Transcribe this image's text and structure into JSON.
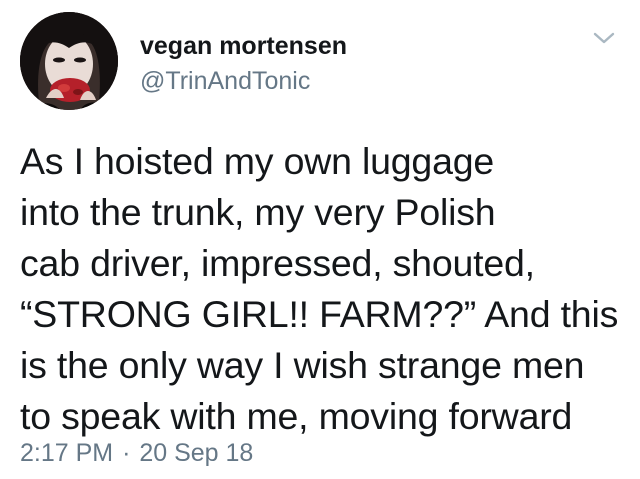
{
  "author": {
    "display_name": "vegan mortensen",
    "handle": "@TrinAndTonic",
    "avatar_icon": "profile-photo"
  },
  "tweet": {
    "lines": [
      "As I hoisted my own luggage",
      "into the trunk, my very Polish",
      "cab driver, impressed, shouted,",
      "“STRONG GIRL!! FARM??” And this",
      "is the only way I wish strange men",
      "to speak with me, moving forward"
    ]
  },
  "meta": {
    "time": "2:17 PM",
    "separator": "·",
    "date": "20 Sep 18"
  },
  "menu": {
    "icon": "chevron-down-icon"
  },
  "colors": {
    "text": "#14171a",
    "secondary": "#657786",
    "background": "#ffffff"
  }
}
